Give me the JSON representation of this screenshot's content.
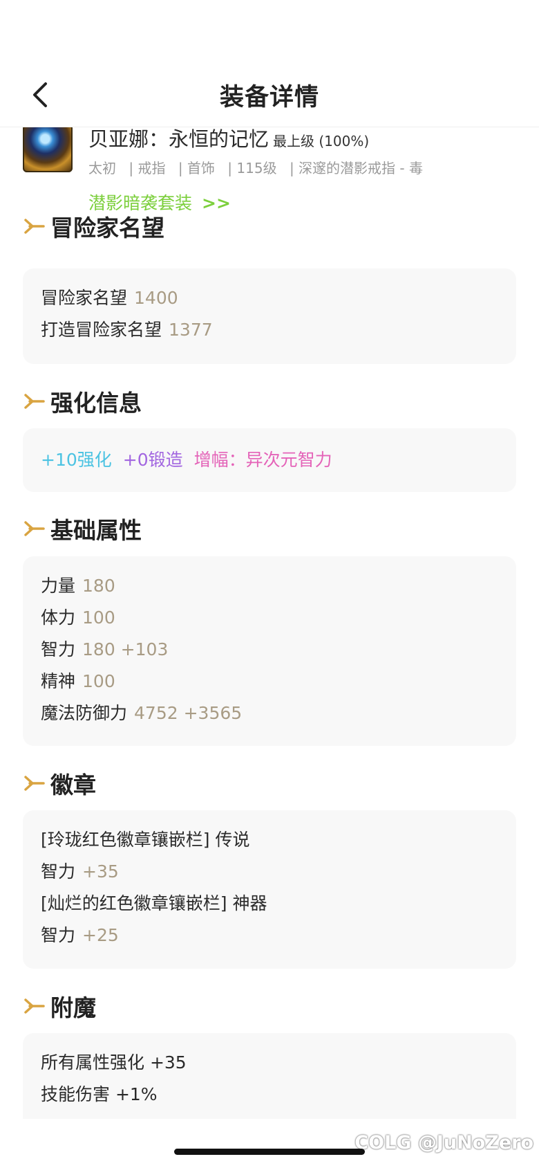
{
  "nav": {
    "title": "装备详情"
  },
  "item": {
    "name": "贝亚娜：永恒的记忆",
    "grade": "最上级 (100%)",
    "meta": [
      "太初",
      "| 戒指",
      "| 首饰",
      "| 115级",
      "| 深邃的潜影戒指 - 毒"
    ],
    "set_name": "潜影暗袭套装",
    "set_arrows": ">>"
  },
  "sections": {
    "reputation": {
      "title": "冒险家名望",
      "rows": [
        {
          "label": "冒险家名望",
          "value": "1400"
        },
        {
          "label": "打造冒险家名望",
          "value": "1377"
        }
      ]
    },
    "enhance": {
      "title": "强化信息",
      "reinforce": "+10强化",
      "forge": "+0锻造",
      "amplify": "增幅：异次元智力"
    },
    "base": {
      "title": "基础属性",
      "rows": [
        {
          "label": "力量",
          "value": "180"
        },
        {
          "label": "体力",
          "value": "100"
        },
        {
          "label": "智力",
          "value": "180 +103"
        },
        {
          "label": "精神",
          "value": "100"
        },
        {
          "label": "魔法防御力",
          "value": "4752 +3565"
        }
      ]
    },
    "emblem": {
      "title": "徽章",
      "rows": [
        {
          "label": "[玲珑红色徽章镶嵌栏] 传说",
          "value": ""
        },
        {
          "label": "智力",
          "value": "+35"
        },
        {
          "label": "[灿烂的红色徽章镶嵌栏] 神器",
          "value": ""
        },
        {
          "label": "智力",
          "value": "+25"
        }
      ]
    },
    "enchant": {
      "title": "附魔",
      "rows": [
        {
          "label": "所有属性强化 +35"
        },
        {
          "label": "技能伤害 +1%"
        }
      ]
    }
  },
  "watermark": "COLG @JuNoZero",
  "colors": {
    "accent_arrow": "#d9a441",
    "set_green": "#7ccf3c",
    "value_tan": "#a89b84"
  }
}
